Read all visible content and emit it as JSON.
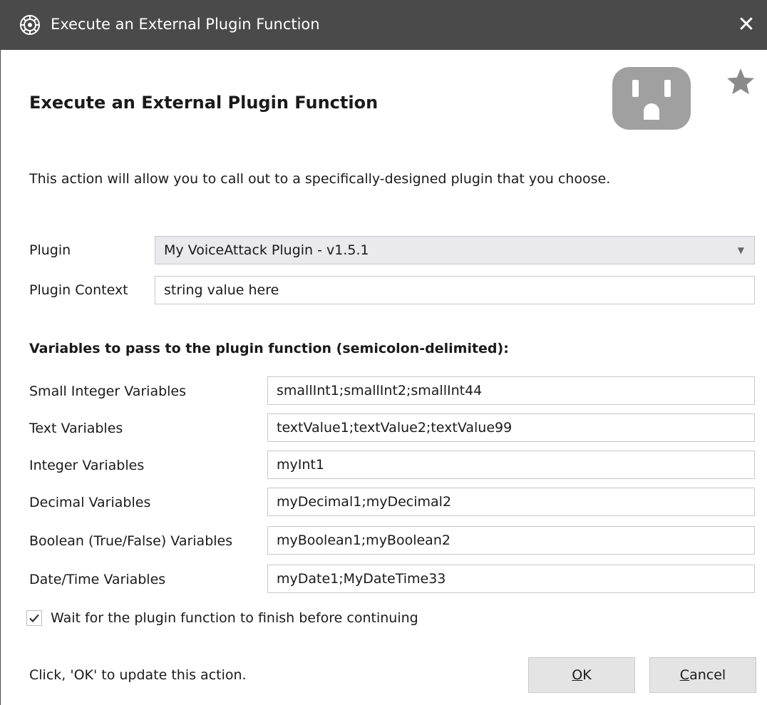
{
  "window": {
    "title": "Execute an External Plugin Function",
    "close_glyph": "✕",
    "icons": {
      "app": "app-gear-icon",
      "close": "close-icon",
      "plugin": "power-outlet-icon",
      "favorite": "star-icon",
      "dropdown": "chevron-down-icon",
      "check": "checkmark-icon"
    }
  },
  "header": {
    "title": "Execute an External Plugin Function"
  },
  "description": "This action will allow you to call out to a specifically-designed plugin that you choose.",
  "plugin": {
    "label": "Plugin",
    "selected": "My VoiceAttack Plugin - v1.5.1",
    "caret": "▼"
  },
  "context": {
    "label": "Plugin Context",
    "value": "string value here"
  },
  "variables": {
    "section_title": "Variables to pass to the plugin function (semicolon-delimited):",
    "small_int": {
      "label": "Small Integer Variables",
      "value": "smallInt1;smallInt2;smallInt44"
    },
    "text": {
      "label": "Text Variables",
      "value": "textValue1;textValue2;textValue99"
    },
    "integer": {
      "label": "Integer Variables",
      "value": "myInt1"
    },
    "decimal": {
      "label": "Decimal Variables",
      "value": "myDecimal1;myDecimal2"
    },
    "boolean": {
      "label": "Boolean (True/False) Variables",
      "value": "myBoolean1;myBoolean2"
    },
    "datetime": {
      "label": "Date/Time Variables",
      "value": "myDate1;MyDateTime33"
    }
  },
  "wait": {
    "label": "Wait for the plugin function to finish before continuing",
    "checked": true
  },
  "footer": {
    "hint": "Click, 'OK' to update this action.",
    "ok_mnemonic": "O",
    "ok_rest": "K",
    "cancel_mnemonic": "C",
    "cancel_rest": "ancel"
  },
  "colors": {
    "titlebar": "#4a4a4a",
    "icon_gray": "#a0a0a0",
    "button_bg": "#e4e4e4",
    "select_bg": "#e9e9ee"
  }
}
